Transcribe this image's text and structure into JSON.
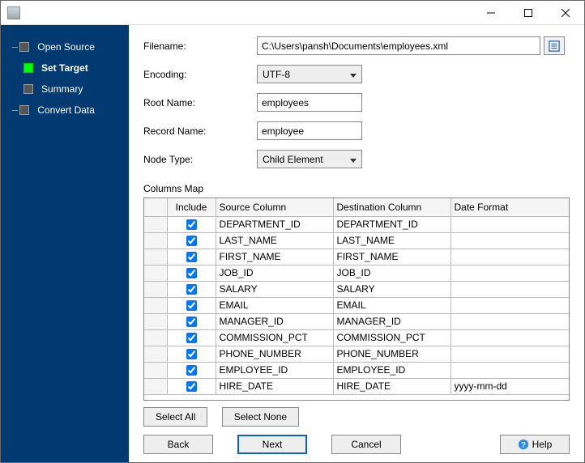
{
  "titlebar": {
    "title": ""
  },
  "sidebar": {
    "steps": [
      {
        "label": "Open Source"
      },
      {
        "label": "Set Target"
      },
      {
        "label": "Summary"
      },
      {
        "label": "Convert Data"
      }
    ]
  },
  "form": {
    "filename_label": "Filename:",
    "filename_value": "C:\\Users\\pansh\\Documents\\employees.xml",
    "encoding_label": "Encoding:",
    "encoding_value": "UTF-8",
    "rootname_label": "Root Name:",
    "rootname_value": "employees",
    "recordname_label": "Record Name:",
    "recordname_value": "employee",
    "nodetype_label": "Node Type:",
    "nodetype_value": "Child Element"
  },
  "columns_map": {
    "label": "Columns Map",
    "headers": {
      "include": "Include",
      "source": "Source Column",
      "dest": "Destination Column",
      "format": "Date Format"
    },
    "rows": [
      {
        "include": true,
        "source": "DEPARTMENT_ID",
        "dest": "DEPARTMENT_ID",
        "format": ""
      },
      {
        "include": true,
        "source": "LAST_NAME",
        "dest": "LAST_NAME",
        "format": ""
      },
      {
        "include": true,
        "source": "FIRST_NAME",
        "dest": "FIRST_NAME",
        "format": ""
      },
      {
        "include": true,
        "source": "JOB_ID",
        "dest": "JOB_ID",
        "format": ""
      },
      {
        "include": true,
        "source": "SALARY",
        "dest": "SALARY",
        "format": ""
      },
      {
        "include": true,
        "source": "EMAIL",
        "dest": "EMAIL",
        "format": ""
      },
      {
        "include": true,
        "source": "MANAGER_ID",
        "dest": "MANAGER_ID",
        "format": ""
      },
      {
        "include": true,
        "source": "COMMISSION_PCT",
        "dest": "COMMISSION_PCT",
        "format": ""
      },
      {
        "include": true,
        "source": "PHONE_NUMBER",
        "dest": "PHONE_NUMBER",
        "format": ""
      },
      {
        "include": true,
        "source": "EMPLOYEE_ID",
        "dest": "EMPLOYEE_ID",
        "format": ""
      },
      {
        "include": true,
        "source": "HIRE_DATE",
        "dest": "HIRE_DATE",
        "format": "yyyy-mm-dd"
      }
    ]
  },
  "buttons": {
    "select_all": "Select All",
    "select_none": "Select None",
    "back": "Back",
    "next": "Next",
    "cancel": "Cancel",
    "help": "Help"
  }
}
